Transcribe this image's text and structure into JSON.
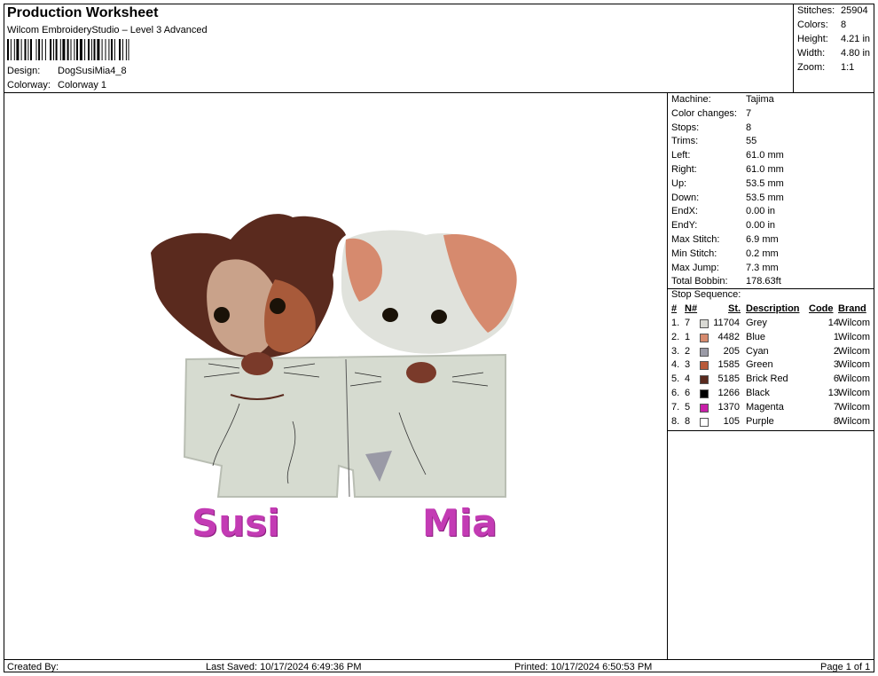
{
  "header": {
    "title": "Production Worksheet",
    "subtitle": "Wilcom EmbroideryStudio – Level 3 Advanced",
    "design_label": "Design:",
    "design_value": "DogSusiMia4_8",
    "colorway_label": "Colorway:",
    "colorway_value": "Colorway 1"
  },
  "summary": [
    {
      "label": "Stitches:",
      "value": "25904"
    },
    {
      "label": "Colors:",
      "value": "8"
    },
    {
      "label": "Height:",
      "value": "4.21 in"
    },
    {
      "label": "Width:",
      "value": "4.80 in"
    },
    {
      "label": "Zoom:",
      "value": "1:1"
    }
  ],
  "stats": [
    {
      "label": "Machine:",
      "value": "Tajima"
    },
    {
      "label": "Color changes:",
      "value": "7"
    },
    {
      "label": "Stops:",
      "value": "8"
    },
    {
      "label": "Trims:",
      "value": "55"
    },
    {
      "label": "Left:",
      "value": "61.0 mm"
    },
    {
      "label": "Right:",
      "value": "61.0 mm"
    },
    {
      "label": "Up:",
      "value": "53.5 mm"
    },
    {
      "label": "Down:",
      "value": "53.5 mm"
    },
    {
      "label": "EndX:",
      "value": "0.00 in"
    },
    {
      "label": "EndY:",
      "value": "0.00 in"
    },
    {
      "label": "Max Stitch:",
      "value": "6.9 mm"
    },
    {
      "label": "Min Stitch:",
      "value": "0.2 mm"
    },
    {
      "label": "Max Jump:",
      "value": "7.3 mm"
    },
    {
      "label": "Total Bobbin:",
      "value": "178.63ft"
    }
  ],
  "stop_sequence": {
    "title": "Stop Sequence:",
    "headers": {
      "num": "#",
      "n": "N#",
      "st": "St.",
      "desc": "Description",
      "code": "Code",
      "brand": "Brand"
    },
    "rows": [
      {
        "num": "1.",
        "n": "7",
        "color": "#d9d9d4",
        "st": "11704",
        "desc": "Grey",
        "code": "14",
        "brand": "Wilcom"
      },
      {
        "num": "2.",
        "n": "1",
        "color": "#d68a6e",
        "st": "4482",
        "desc": "Blue",
        "code": "1",
        "brand": "Wilcom"
      },
      {
        "num": "3.",
        "n": "2",
        "color": "#9a9aa6",
        "st": "205",
        "desc": "Cyan",
        "code": "2",
        "brand": "Wilcom"
      },
      {
        "num": "4.",
        "n": "3",
        "color": "#b85a3a",
        "st": "1585",
        "desc": "Green",
        "code": "3",
        "brand": "Wilcom"
      },
      {
        "num": "5.",
        "n": "4",
        "color": "#5a2a1e",
        "st": "5185",
        "desc": "Brick Red",
        "code": "6",
        "brand": "Wilcom"
      },
      {
        "num": "6.",
        "n": "6",
        "color": "#000000",
        "st": "1266",
        "desc": "Black",
        "code": "13",
        "brand": "Wilcom"
      },
      {
        "num": "7.",
        "n": "5",
        "color": "#c81fa8",
        "st": "1370",
        "desc": "Magenta",
        "code": "7",
        "brand": "Wilcom"
      },
      {
        "num": "8.",
        "n": "8",
        "color": "#ffffff",
        "st": "105",
        "desc": "Purple",
        "code": "8",
        "brand": "Wilcom"
      }
    ]
  },
  "design": {
    "name_left": "Susi",
    "name_right": "Mia"
  },
  "footer": {
    "created_by": "Created By:",
    "last_saved": "Last Saved: 10/17/2024 6:49:36 PM",
    "printed": "Printed: 10/17/2024 6:50:53 PM",
    "page": "Page 1 of 1"
  }
}
